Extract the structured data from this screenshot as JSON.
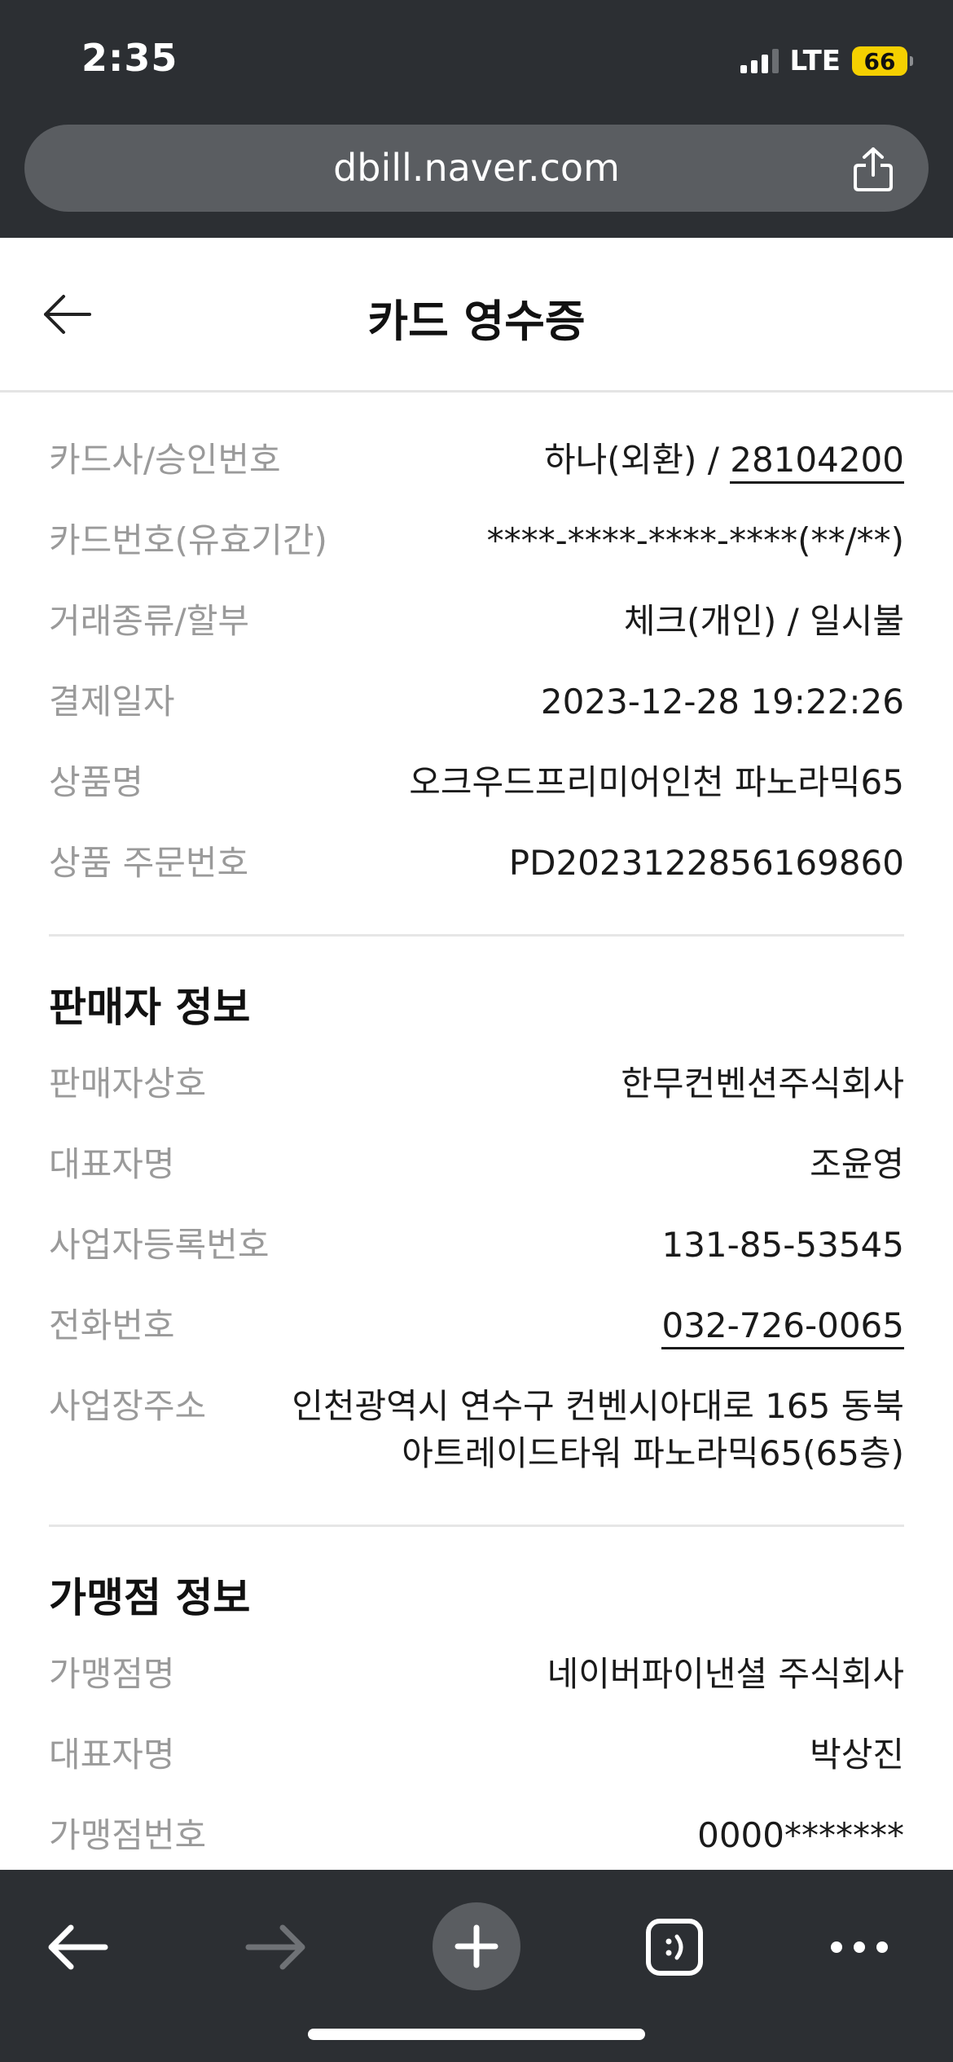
{
  "status_bar": {
    "time": "2:35",
    "network": "LTE",
    "battery": "66"
  },
  "browser": {
    "url": "dbill.naver.com"
  },
  "header": {
    "title": "카드 영수증"
  },
  "payment": [
    {
      "label": "카드사/승인번호",
      "value_prefix": "하나(외환) / ",
      "value_link": "28104200"
    },
    {
      "label": "카드번호(유효기간)",
      "value": "****-****-****-****(**/**)"
    },
    {
      "label": "거래종류/할부",
      "value": "체크(개인) / 일시불"
    },
    {
      "label": "결제일자",
      "value": "2023-12-28 19:22:26"
    },
    {
      "label": "상품명",
      "value": "오크우드프리미어인천 파노라믹65"
    },
    {
      "label": "상품 주문번호",
      "value": "PD2023122856169860"
    }
  ],
  "seller": {
    "title": "판매자 정보",
    "rows": [
      {
        "label": "판매자상호",
        "value": "한무컨벤션주식회사"
      },
      {
        "label": "대표자명",
        "value": "조윤영"
      },
      {
        "label": "사업자등록번호",
        "value": "131-85-53545"
      },
      {
        "label": "전화번호",
        "value": "032-726-0065"
      },
      {
        "label": "사업장주소",
        "value_line1": "인천광역시 연수구 컨벤시아대로 165 동북",
        "value_line2": "아트레이드타워 파노라믹65(65층)"
      }
    ]
  },
  "merchant": {
    "title": "가맹점 정보",
    "rows": [
      {
        "label": "가맹점명",
        "value": "네이버파이낸셜 주식회사"
      },
      {
        "label": "대표자명",
        "value": "박상진"
      },
      {
        "label": "가맹점번호",
        "value": "0000*******"
      }
    ]
  },
  "colors": {
    "chrome": "#2c2f33",
    "accent_green": "#19b45a",
    "label_gray": "#9a9a9a"
  },
  "icons": {
    "back": "arrow-left-icon",
    "share": "share-icon",
    "nav_back": "chevron-left-icon",
    "nav_forward": "chevron-right-icon",
    "new_tab": "plus-icon",
    "tabs": "tabs-icon",
    "more": "more-icon"
  }
}
